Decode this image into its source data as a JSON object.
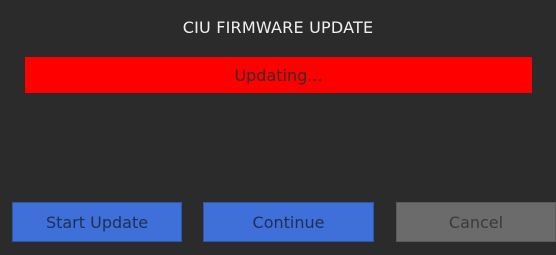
{
  "dialog": {
    "title": "CIU FIRMWARE UPDATE",
    "status_text": "Updating...",
    "colors": {
      "background": "#2b2b2b",
      "status_bar": "#ff0000",
      "primary_button": "#3f6fd8",
      "disabled_button": "#6b6b6b"
    }
  },
  "buttons": {
    "start_update": "Start Update",
    "continue": "Continue",
    "cancel": "Cancel"
  }
}
